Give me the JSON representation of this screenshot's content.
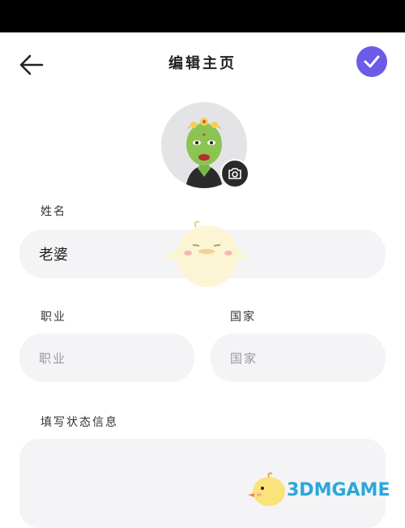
{
  "header": {
    "title": "编辑主页",
    "accent_color": "#6c5be6",
    "back_icon": "arrow-left-icon",
    "confirm_icon": "check-icon"
  },
  "profile": {
    "avatar_icon": "avatar-image",
    "camera_icon": "camera-icon"
  },
  "form": {
    "name_label": "姓名",
    "name_value": "老婆",
    "job_label": "职业",
    "job_placeholder": "职业",
    "country_label": "国家",
    "country_placeholder": "国家",
    "status_label": "填写状态信息",
    "status_value": ""
  },
  "watermark": {
    "text": "3DMGAME"
  }
}
